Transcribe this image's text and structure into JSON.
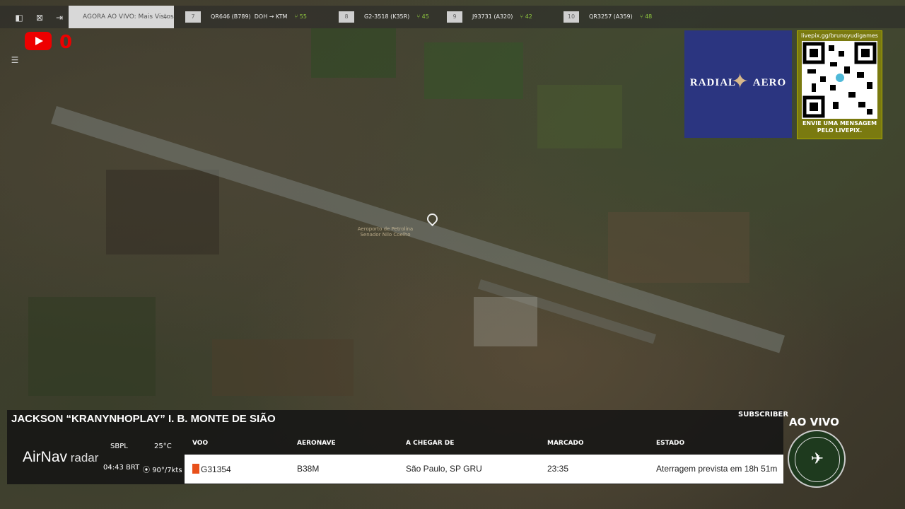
{
  "topbar": {
    "live_select": "AGORA AO VIVO: Mais Vistos",
    "flights": [
      {
        "num": "7",
        "code": "QR646 (B789)",
        "route": "DOH → KTM",
        "seats": "55"
      },
      {
        "num": "8",
        "code": "G2-3518 (K35R)",
        "route": "",
        "seats": "45"
      },
      {
        "num": "9",
        "code": "J93731 (A320)",
        "route": "",
        "seats": "42"
      },
      {
        "num": "10",
        "code": "QR3257 (A359)",
        "route": "",
        "seats": "48"
      }
    ]
  },
  "youtube": {
    "count": "0"
  },
  "map": {
    "airport_label": "Aeroporto de Petrolina Senador Nilo Coelho"
  },
  "sponsor": {
    "left": "RADIAL",
    "right": "AERO"
  },
  "qr": {
    "top": "livepix.gg/brunoyudigames",
    "bottom": "ENVIE UMA MENSAGEM PELO LIVEPIX."
  },
  "panel": {
    "title": "JACKSON “KRANYNHOPLAY” I. B. MONTE DE SIÃO",
    "subscriber": "SUBSCRIBER",
    "brand_main": "AirNav",
    "brand_sub": " radar",
    "airport": "SBPL",
    "temp": "25°C",
    "time": "04:43 BRT",
    "wind": "90°/7kts",
    "headers": {
      "voo": "VOO",
      "aeronave": "AERONAVE",
      "origem": "A CHEGAR DE",
      "marcado": "MARCADO",
      "estado": "ESTADO"
    },
    "row": {
      "voo": "G31354",
      "aeronave": "B38M",
      "origem": "São Paulo, SP GRU",
      "marcado": "23:35",
      "estado": "Aterragem prevista em 18h 51m"
    }
  },
  "live": {
    "label": "AO VIVO"
  }
}
